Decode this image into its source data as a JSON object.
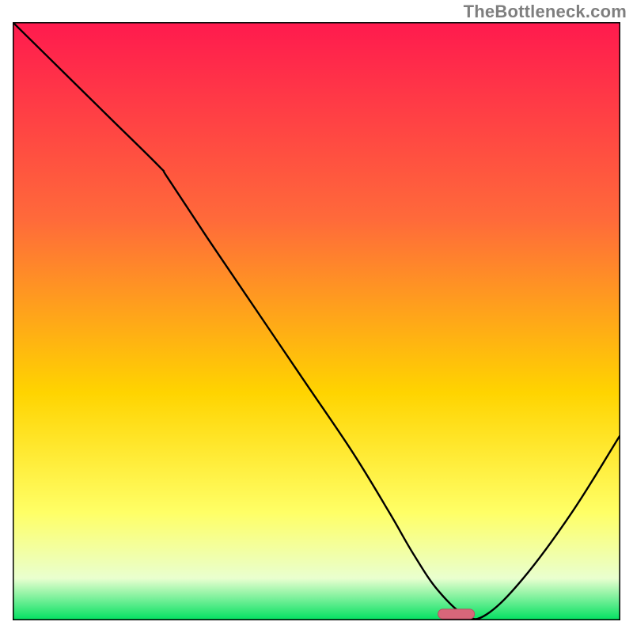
{
  "watermark": "TheBottleneck.com",
  "colors": {
    "gradient_top": "#ff1a4e",
    "gradient_mid1": "#ff6a3a",
    "gradient_mid2": "#ffd400",
    "gradient_mid3": "#ffff66",
    "gradient_mid4": "#e9ffcf",
    "gradient_bottom": "#00e060",
    "frame": "#000000",
    "curve": "#000000",
    "marker_fill": "#d8667a",
    "marker_stroke": "#b94f63"
  },
  "chart_data": {
    "type": "line",
    "title": "",
    "xlabel": "",
    "ylabel": "",
    "xlim": [
      0,
      100
    ],
    "ylim": [
      0,
      100
    ],
    "grid": false,
    "legend": false,
    "annotations": [],
    "series": [
      {
        "name": "bottleneck-curve",
        "x": [
          0,
          8,
          16,
          24,
          25.5,
          32,
          40,
          48,
          56,
          62,
          66,
          70,
          74.5,
          78,
          84,
          92,
          100
        ],
        "y": [
          100,
          92,
          84,
          76,
          74,
          64,
          52,
          40,
          28,
          18,
          11,
          5,
          0.8,
          1,
          7,
          18,
          31
        ]
      }
    ],
    "marker": {
      "x_center": 73,
      "width": 6,
      "height": 1.6
    }
  }
}
